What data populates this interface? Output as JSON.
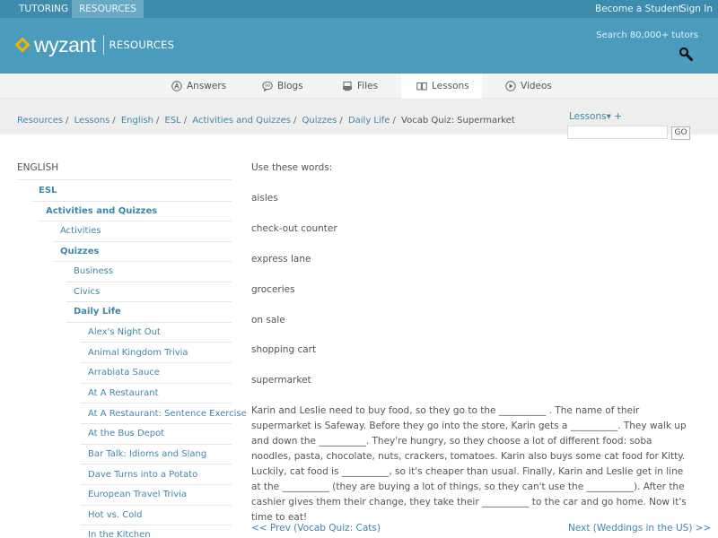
{
  "topbar": {
    "tabs": [
      {
        "label": "TUTORING"
      },
      {
        "label": "RESOURCES"
      }
    ],
    "become_student": "Become a Student",
    "sign_in": "Sign In"
  },
  "header": {
    "logo_text": "wyzant",
    "logo_sub": "RESOURCES",
    "search_tutors": "Search 80,000+ tutors"
  },
  "nav": {
    "items": [
      {
        "label": "Answers",
        "icon": "answers-icon"
      },
      {
        "label": "Blogs",
        "icon": "blogs-icon"
      },
      {
        "label": "Files",
        "icon": "files-icon"
      },
      {
        "label": "Lessons",
        "icon": "lessons-icon"
      },
      {
        "label": "Videos",
        "icon": "videos-icon"
      }
    ],
    "active": "Lessons"
  },
  "breadcrumb": {
    "links": [
      "Resources",
      "Lessons",
      "English",
      "ESL",
      "Activities and Quizzes",
      "Quizzes",
      "Daily Life"
    ],
    "current": "Vocab Quiz: Supermarket"
  },
  "lessons_dropdown": "Lessons▾ +",
  "site_search": {
    "value": "",
    "go": "GO"
  },
  "sidebar": {
    "title": "ENGLISH",
    "items": [
      {
        "label": "ESL"
      },
      {
        "label": "Activities and Quizzes"
      },
      {
        "label": "Activities"
      },
      {
        "label": "Quizzes"
      },
      {
        "label": "Business"
      },
      {
        "label": "Civics"
      },
      {
        "label": "Daily Life"
      },
      {
        "label": "Alex's Night Out"
      },
      {
        "label": "Animal Kingdom Trivia"
      },
      {
        "label": "Arrabiata Sauce"
      },
      {
        "label": "At A Restaurant"
      },
      {
        "label": "At A Restaurant: Sentence Exercise"
      },
      {
        "label": "At the Bus Depot"
      },
      {
        "label": "Bar Talk: Idioms and Slang"
      },
      {
        "label": "Dave Turns into a Potato"
      },
      {
        "label": "European Travel Trivia"
      },
      {
        "label": "Hot vs. Cold"
      },
      {
        "label": "In the Kitchen"
      }
    ]
  },
  "content": {
    "intro": "Use these words:",
    "words": [
      "aisles",
      "check-out counter",
      "express lane",
      "groceries",
      "on sale",
      "shopping cart",
      "supermarket"
    ],
    "story": "Karin and Leslie need to buy food, so they go to the __________ . The name of their supermarket is Safeway. Before they go into the store, Karin gets a __________. They walk up and down the __________. They're hungry, so they choose a lot of different food: soba noodles, pasta, chocolate, nuts, crackers, tomatoes. Karin also buys some cat food for Kitty. Luckily, cat food is __________, so it's cheaper than usual. Finally, Karin and Leslie get in line at the __________ (they are buying a lot of things, so they can't use the __________). After the cashier gives them their change, they take their __________ to the car and go home. Now it's time to eat!",
    "prev": "<< Prev (Vocab Quiz: Cats)",
    "next": "Next (Weddings in the US) >>"
  }
}
